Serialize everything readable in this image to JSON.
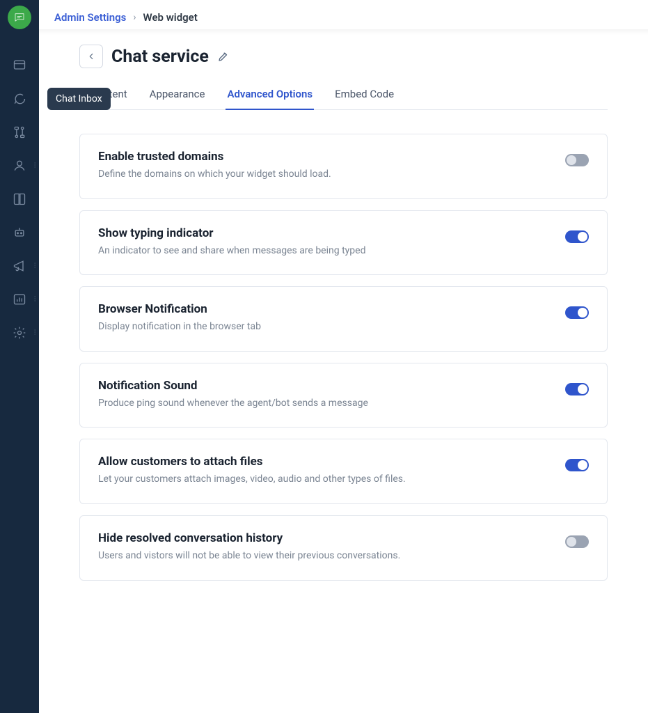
{
  "breadcrumb": {
    "parent": "Admin Settings",
    "current": "Web widget"
  },
  "tooltip": "Chat Inbox",
  "page": {
    "title": "Chat service"
  },
  "tabs": [
    {
      "label": "Content",
      "active": false
    },
    {
      "label": "Appearance",
      "active": false
    },
    {
      "label": "Advanced Options",
      "active": true
    },
    {
      "label": "Embed Code",
      "active": false
    }
  ],
  "settings": [
    {
      "title": "Enable trusted domains",
      "desc": "Define the domains on which your widget should load.",
      "on": false
    },
    {
      "title": "Show typing indicator",
      "desc": "An indicator to see and share when messages are being typed",
      "on": true
    },
    {
      "title": "Browser Notification",
      "desc": "Display notification in the browser tab",
      "on": true
    },
    {
      "title": "Notification Sound",
      "desc": "Produce ping sound whenever the agent/bot sends a message",
      "on": true
    },
    {
      "title": "Allow customers to attach files",
      "desc": "Let your customers attach images, video, audio and other types of files.",
      "on": true
    },
    {
      "title": "Hide resolved conversation history",
      "desc": "Users and vistors will not be able to view their previous conversations.",
      "on": false
    }
  ],
  "sidebar": {
    "items": [
      {
        "name": "dashboards-icon",
        "dots": false
      },
      {
        "name": "chat-icon",
        "dots": false
      },
      {
        "name": "flows-icon",
        "dots": false
      },
      {
        "name": "contacts-icon",
        "dots": true
      },
      {
        "name": "book-icon",
        "dots": false
      },
      {
        "name": "bot-icon",
        "dots": false
      },
      {
        "name": "campaigns-icon",
        "dots": true
      },
      {
        "name": "reports-icon",
        "dots": true
      },
      {
        "name": "settings-icon",
        "dots": true
      }
    ]
  }
}
